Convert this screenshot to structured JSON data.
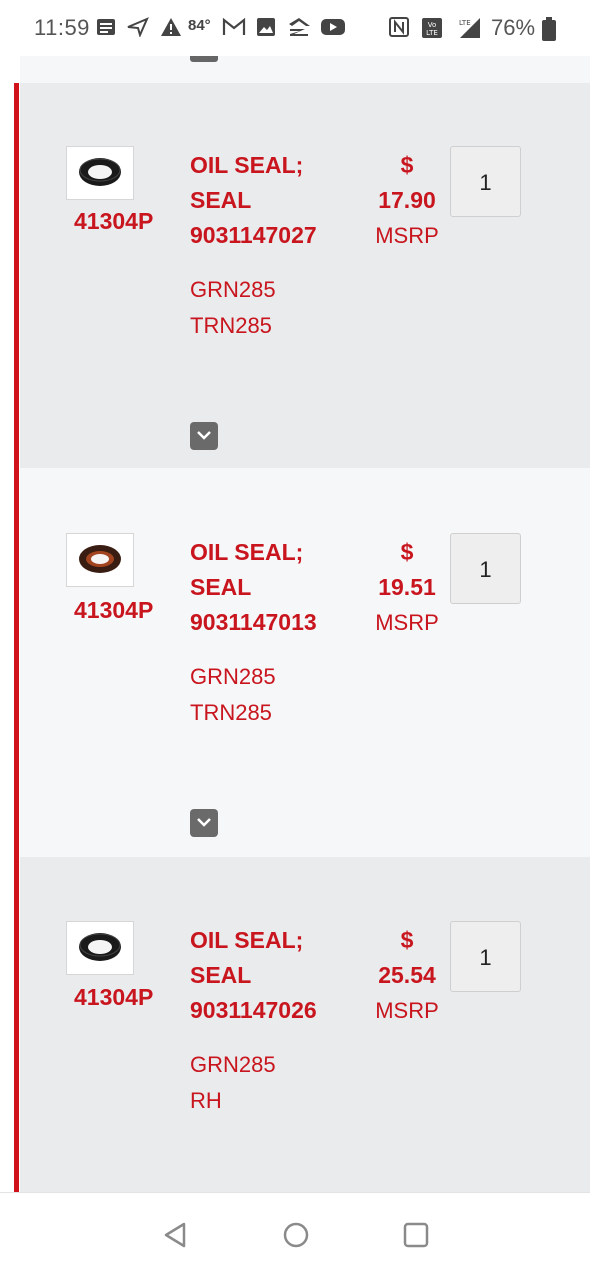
{
  "status_bar": {
    "time": "11:59",
    "temperature": "84°",
    "battery": "76%",
    "icons": [
      "message-icon",
      "send-icon",
      "warning-icon",
      "gmail-icon",
      "photo-icon",
      "zillow-icon",
      "youtube-icon",
      "nfc-icon",
      "volte-icon",
      "lte-signal-icon",
      "battery-icon"
    ]
  },
  "colors": {
    "accent": "#c8151e",
    "row_shade": "#e9ebec",
    "row_light": "#f6f7f8"
  },
  "items": [
    {
      "part_no": "41304P",
      "title_line1": "OIL SEAL;",
      "title_line2": "SEAL",
      "number": "9031147027",
      "currency": "$",
      "price": "17.90",
      "msrp": "MSRP",
      "codes": [
        "GRN285",
        "TRN285"
      ],
      "qty": "1"
    },
    {
      "part_no": "41304P",
      "title_line1": "OIL SEAL;",
      "title_line2": "SEAL",
      "number": "9031147013",
      "currency": "$",
      "price": "19.51",
      "msrp": "MSRP",
      "codes": [
        "GRN285",
        "TRN285"
      ],
      "qty": "1"
    },
    {
      "part_no": "41304P",
      "title_line1": "OIL SEAL;",
      "title_line2": "SEAL",
      "number": "9031147026",
      "currency": "$",
      "price": "25.54",
      "msrp": "MSRP",
      "codes": [
        "GRN285",
        "RH"
      ],
      "qty": "1"
    }
  ],
  "nav": {
    "buttons": [
      "back-icon",
      "home-icon",
      "recents-icon"
    ]
  }
}
